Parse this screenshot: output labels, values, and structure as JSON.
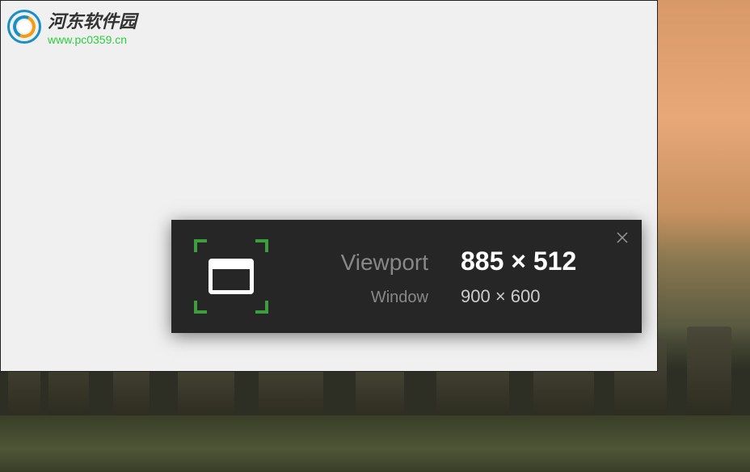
{
  "watermark": {
    "title": "河东软件园",
    "url": "www.pc0359.cn"
  },
  "overlay": {
    "viewport": {
      "label": "Viewport",
      "value": "885 × 512"
    },
    "window": {
      "label": "Window",
      "value": "900 × 600"
    }
  },
  "colors": {
    "panel_bg": "#262626",
    "accent_green": "#3d9e3d",
    "text_muted": "#888",
    "text_primary": "#fff"
  }
}
